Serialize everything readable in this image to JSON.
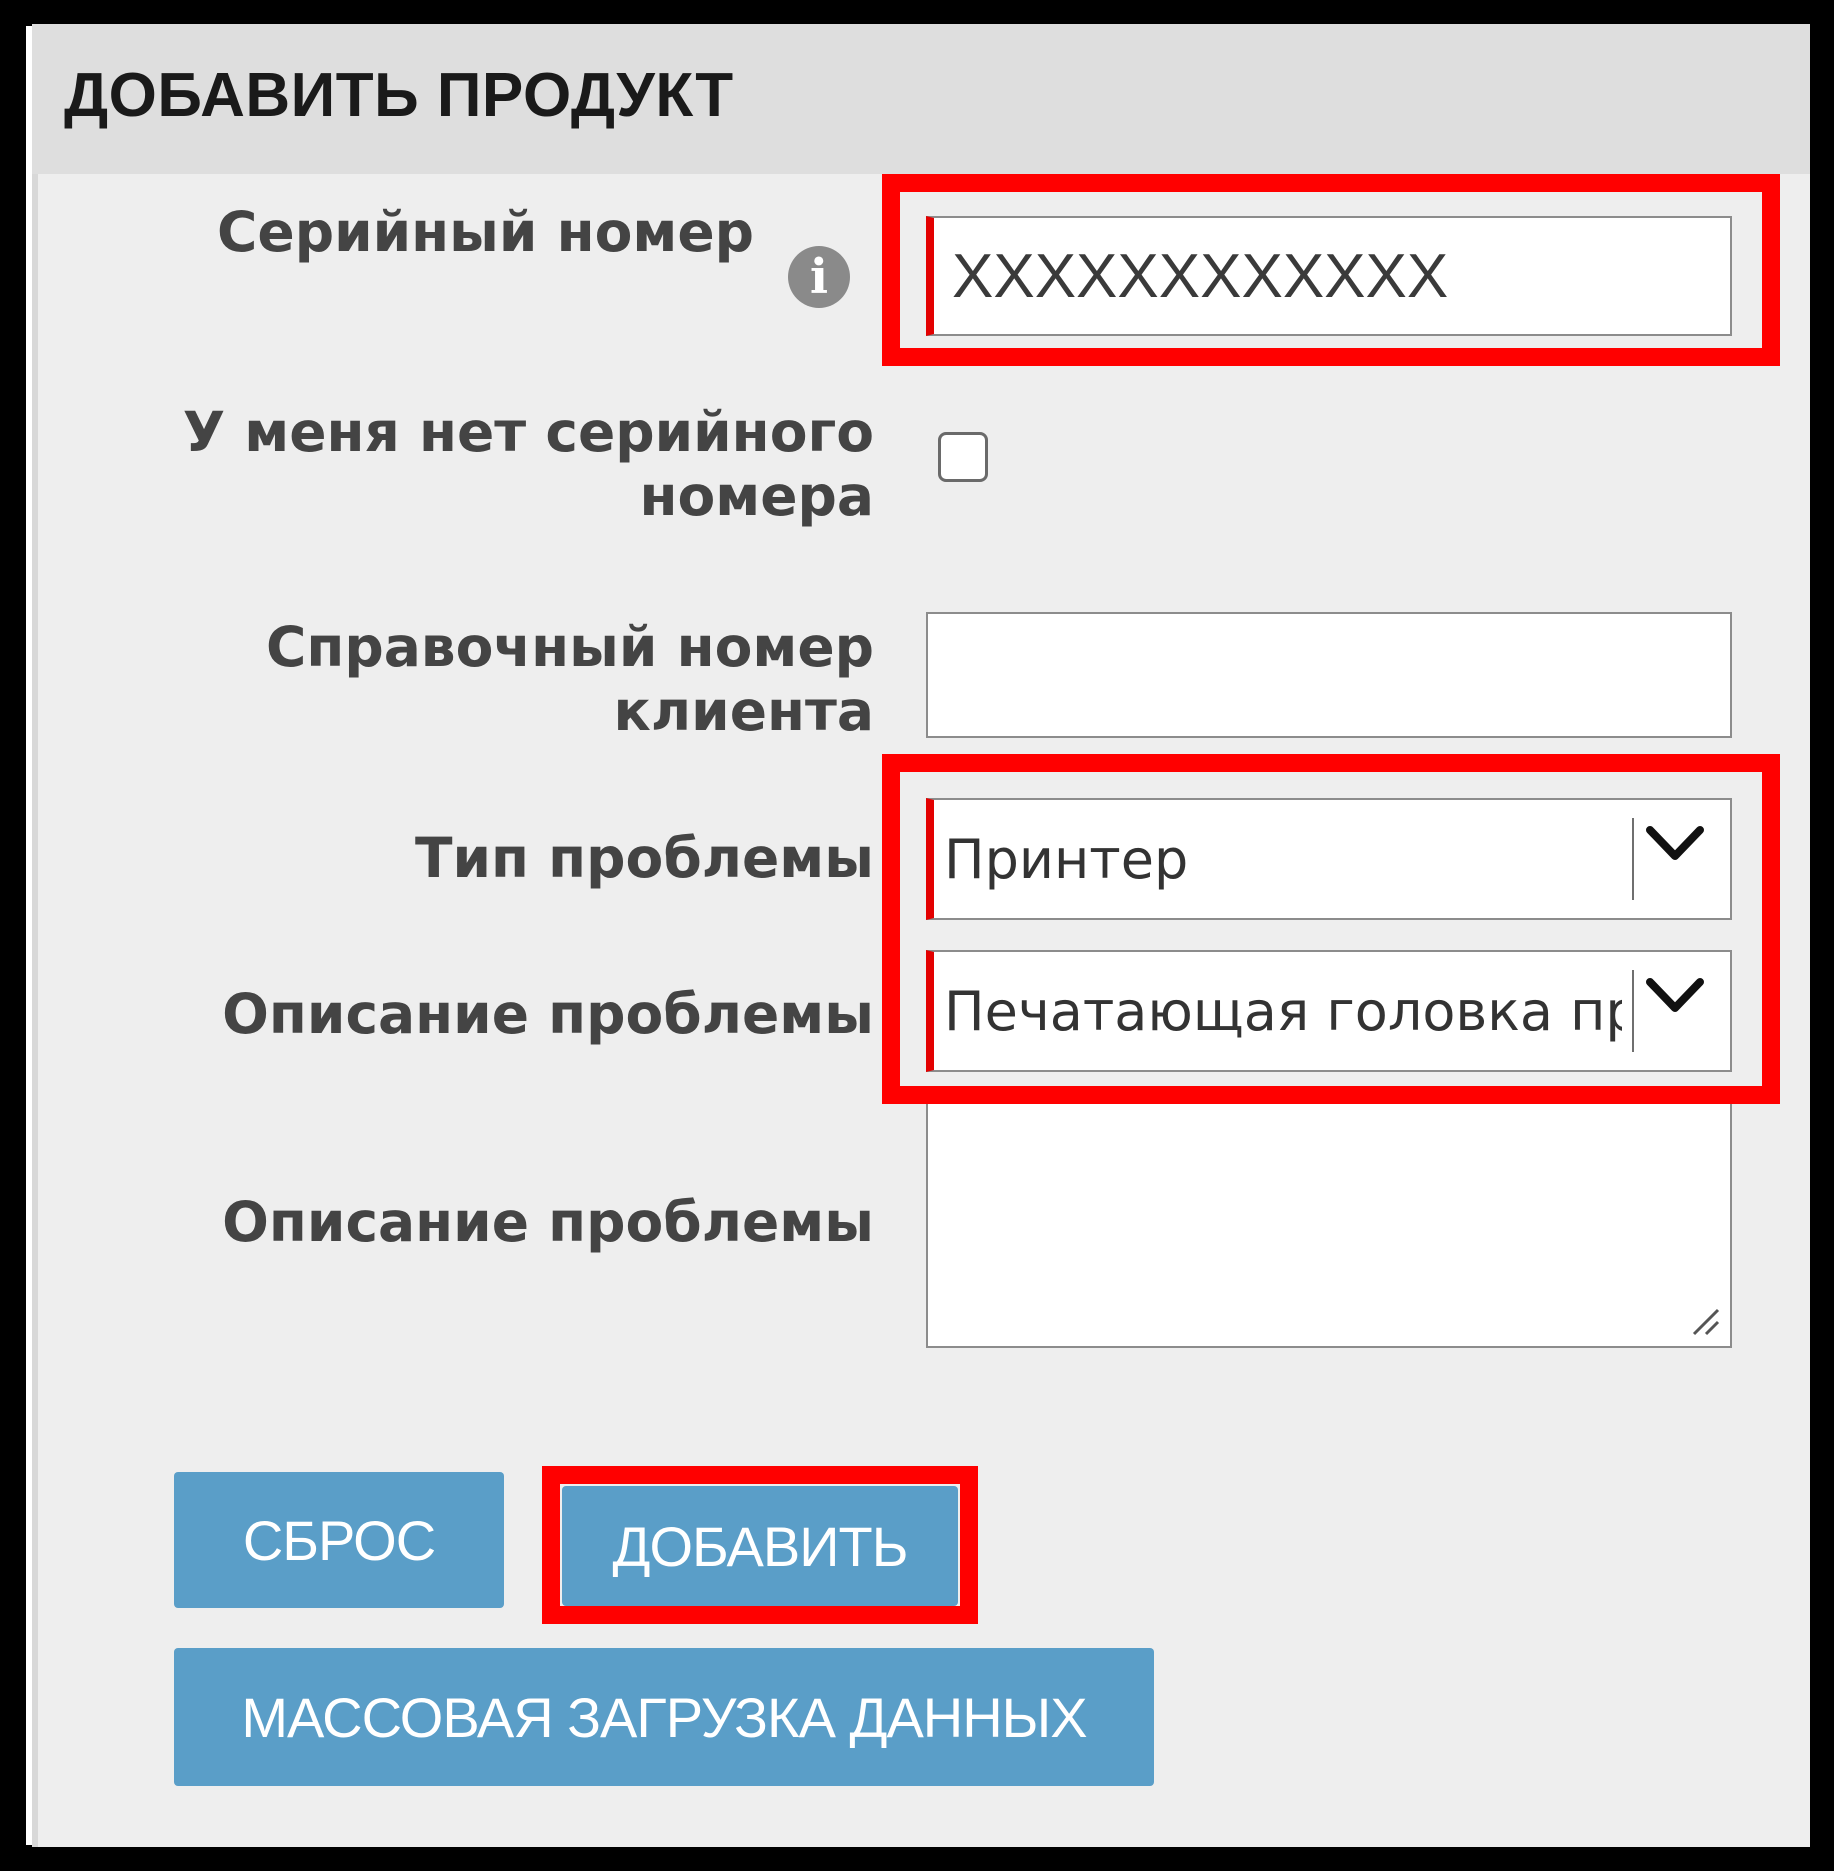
{
  "header": {
    "title": "ДОБАВИТЬ ПРОДУКТ"
  },
  "form": {
    "serial": {
      "label": "Серийный номер",
      "value": "XXXXXXXXXXXX",
      "info_icon": "info-icon"
    },
    "no_serial": {
      "label_line1": "У меня нет серийного",
      "label_line2": "номера",
      "checked": false
    },
    "customer_ref": {
      "label_line1": "Справочный номер",
      "label_line2": "клиента",
      "value": ""
    },
    "problem_type": {
      "label": "Тип проблемы",
      "selected": "Принтер"
    },
    "problem_desc_select": {
      "label": "Описание проблемы",
      "selected": "Печатающая головка пр"
    },
    "problem_desc_text": {
      "label": "Описание проблемы",
      "value": ""
    }
  },
  "buttons": {
    "reset": "СБРОС",
    "add": "ДОБАВИТЬ",
    "bulk_upload": "МАССОВАЯ ЗАГРУЗКА ДАННЫХ"
  },
  "colors": {
    "button": "#5a9ec8",
    "highlight": "#ff0000",
    "required_marker": "#e30000",
    "header_bg": "#dedede",
    "panel_bg": "#eeeeee"
  }
}
